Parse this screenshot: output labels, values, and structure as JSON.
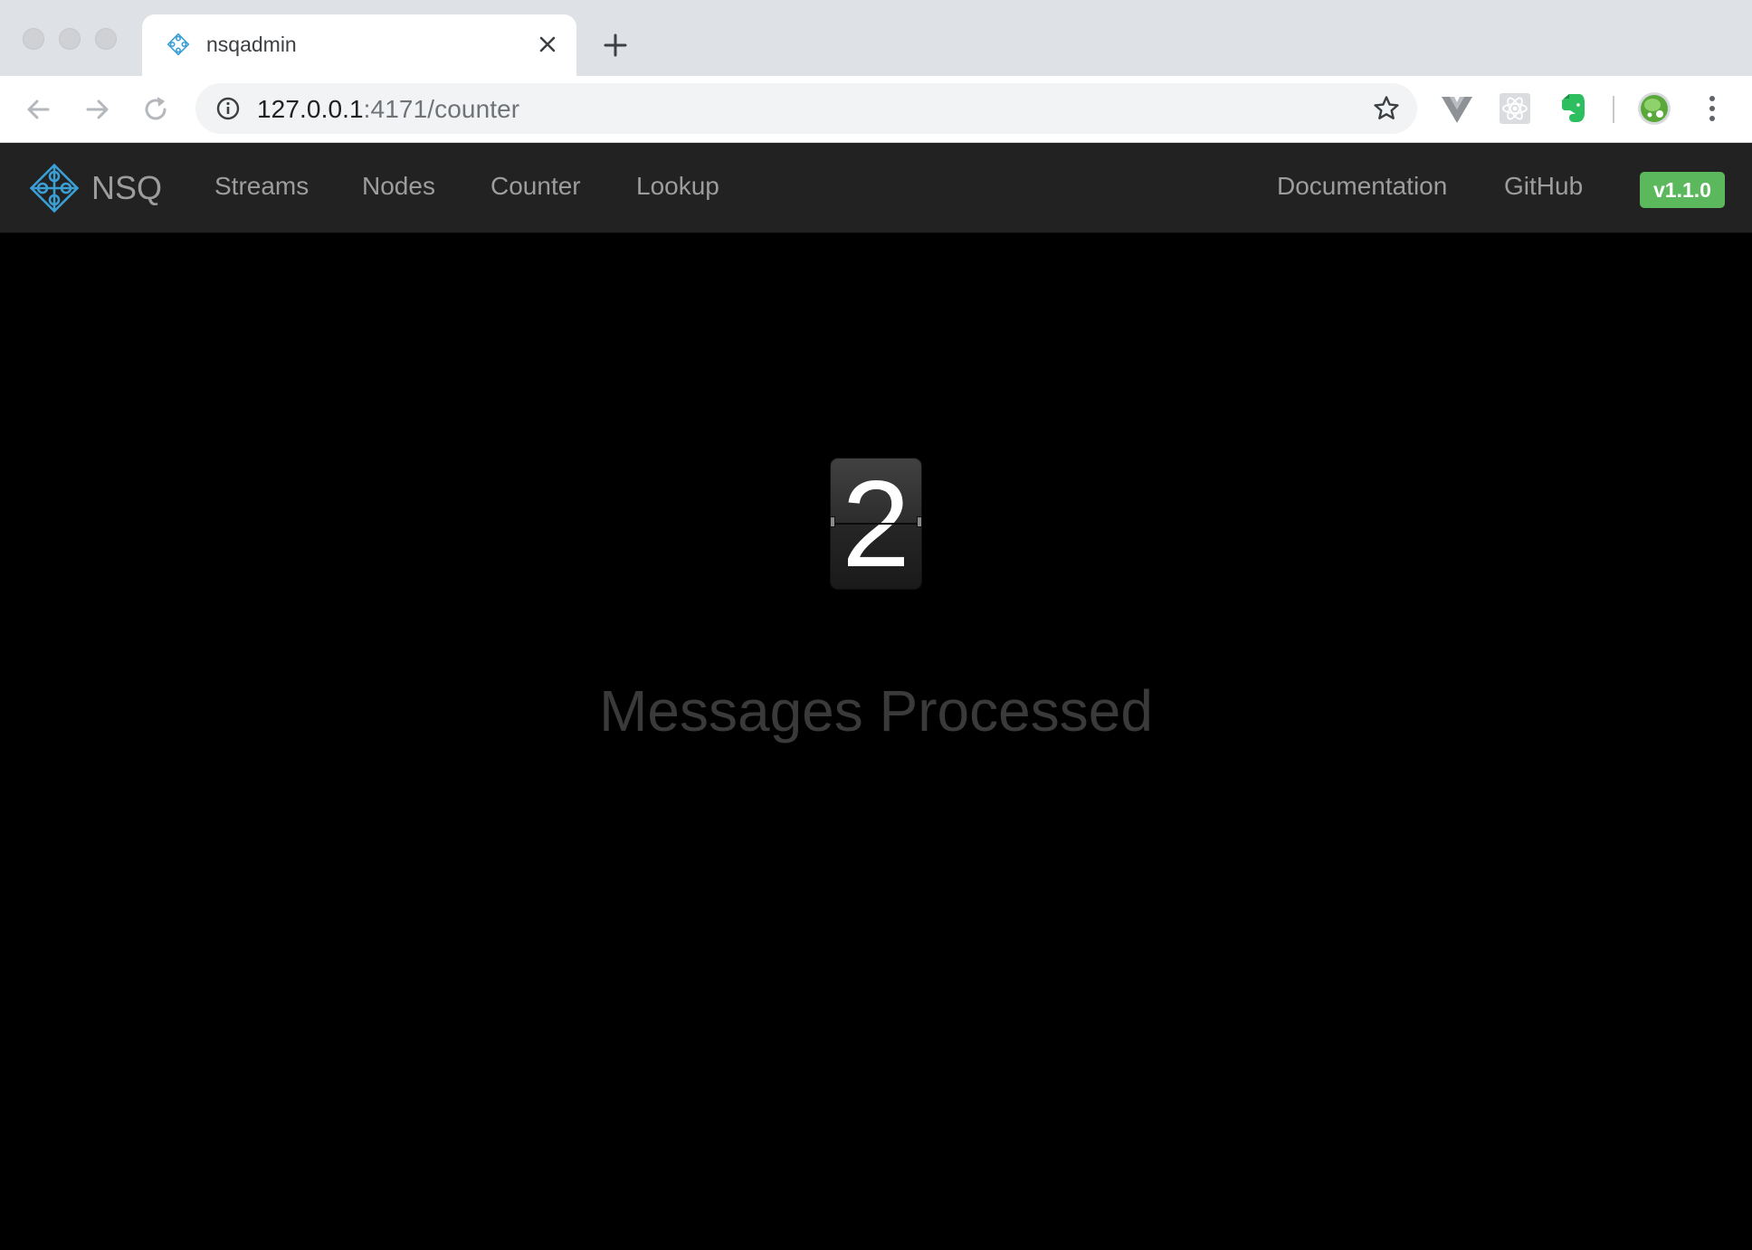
{
  "browser": {
    "tab": {
      "title": "nsqadmin"
    },
    "address": {
      "host": "127.0.0.1",
      "rest": ":4171/counter"
    }
  },
  "navbar": {
    "brand": "NSQ",
    "links": [
      "Streams",
      "Nodes",
      "Counter",
      "Lookup"
    ],
    "right_links": [
      "Documentation",
      "GitHub"
    ],
    "version": "v1.1.0"
  },
  "counter": {
    "digits": [
      "2"
    ],
    "label": "Messages Processed"
  },
  "colors": {
    "navbar_bg": "#222222",
    "nav_text": "#9d9d9d",
    "badge_green": "#5cb85c",
    "nsq_logo_blue": "#3b9fd6",
    "label_gray": "#3a3a3a"
  },
  "icons": [
    "nsq-logo-icon",
    "back-arrow-icon",
    "forward-arrow-icon",
    "reload-icon",
    "info-icon",
    "star-icon",
    "vue-devtools-icon",
    "react-devtools-icon",
    "evernote-icon",
    "profile-avatar-icon",
    "kebab-menu-icon",
    "close-icon",
    "plus-icon"
  ]
}
